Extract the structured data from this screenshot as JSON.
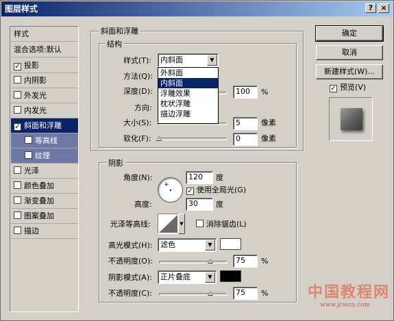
{
  "window": {
    "title": "图层样式",
    "help_icon": "?",
    "close_icon": "×"
  },
  "sidebar": {
    "header": "样式",
    "blend_options": "混合选项:默认",
    "items": [
      {
        "label": "投影",
        "checked": true
      },
      {
        "label": "内阴影",
        "checked": false
      },
      {
        "label": "外发光",
        "checked": false
      },
      {
        "label": "内发光",
        "checked": false
      },
      {
        "label": "斜面和浮雕",
        "checked": true
      },
      {
        "label": "等高线",
        "checked": false
      },
      {
        "label": "纹理",
        "checked": false
      },
      {
        "label": "光泽",
        "checked": false
      },
      {
        "label": "颜色叠加",
        "checked": false
      },
      {
        "label": "渐变叠加",
        "checked": false
      },
      {
        "label": "图案叠加",
        "checked": false
      },
      {
        "label": "描边",
        "checked": false
      }
    ]
  },
  "bevel": {
    "group_title": "斜面和浮雕",
    "structure_title": "结构",
    "style_label": "样式(T):",
    "style_value": "内斜面",
    "style_options": [
      "外斜面",
      "内斜面",
      "浮雕效果",
      "枕状浮雕",
      "描边浮雕"
    ],
    "method_label": "方法(Q):",
    "depth_label": "深度(D):",
    "depth_value": "100",
    "depth_unit": "%",
    "direction_label": "方向:",
    "size_label": "大小(S):",
    "size_value": "5",
    "size_unit": "像素",
    "soften_label": "软化(F):",
    "soften_value": "0",
    "soften_unit": "像素"
  },
  "shading": {
    "title": "阴影",
    "angle_label": "角度(N):",
    "angle_value": "120",
    "angle_unit": "度",
    "global_light_label": "使用全局光(G)",
    "global_light_checked": true,
    "altitude_label": "高度:",
    "altitude_value": "30",
    "altitude_unit": "度",
    "gloss_contour_label": "光泽等高线:",
    "anti_alias_label": "消除锯齿(L)",
    "anti_alias_checked": false,
    "highlight_mode_label": "高光模式(H):",
    "highlight_mode_value": "滤色",
    "highlight_color": "#ffffff",
    "highlight_opacity_label": "不透明度(O):",
    "highlight_opacity_value": "75",
    "highlight_opacity_unit": "%",
    "shadow_mode_label": "阴影模式(A):",
    "shadow_mode_value": "正片叠底",
    "shadow_color": "#000000",
    "shadow_opacity_label": "不透明度(C):",
    "shadow_opacity_value": "75",
    "shadow_opacity_unit": "%"
  },
  "buttons": {
    "ok": "确定",
    "cancel": "取消",
    "new_style": "新建样式(W)...",
    "preview_label": "预览(V)",
    "preview_checked": true
  },
  "watermark": {
    "big": "中国教程网",
    "small": "www.jcwcn.com"
  }
}
